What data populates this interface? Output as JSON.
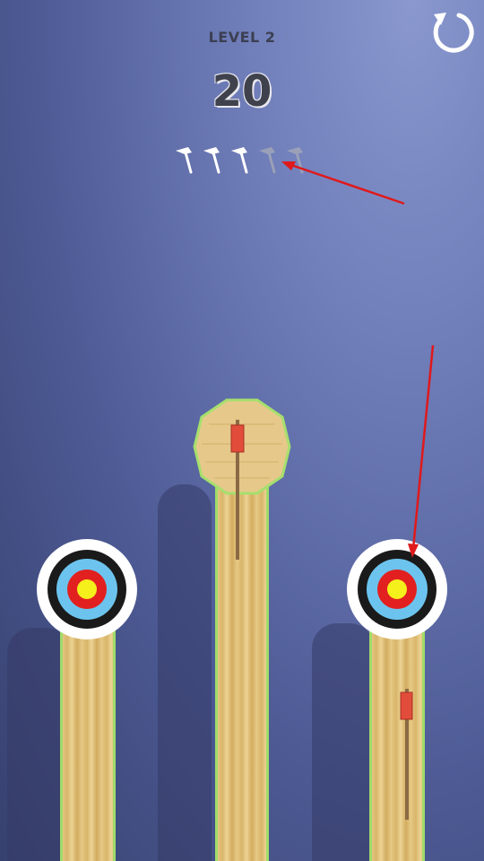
{
  "hud": {
    "level_label": "LEVEL 2",
    "score": "20",
    "restart_icon": "restart-icon",
    "axes_total": 5,
    "axes_remaining": 3
  },
  "scene": {
    "targets": [
      {
        "name": "left-bullseye-target",
        "type": "bullseye"
      },
      {
        "name": "center-wood-log-target",
        "type": "wood-log"
      },
      {
        "name": "right-bullseye-target",
        "type": "bullseye"
      }
    ]
  },
  "colors": {
    "background": "#6e7cb8",
    "wood": "#e4c680",
    "pillar_edge": "#9fdc6a",
    "ring_black": "#1a1a1a",
    "ring_blue": "#6cc4ee",
    "ring_red": "#e2201f",
    "ring_yellow": "#f5ef1c",
    "annotation_arrow": "#e0191b"
  }
}
